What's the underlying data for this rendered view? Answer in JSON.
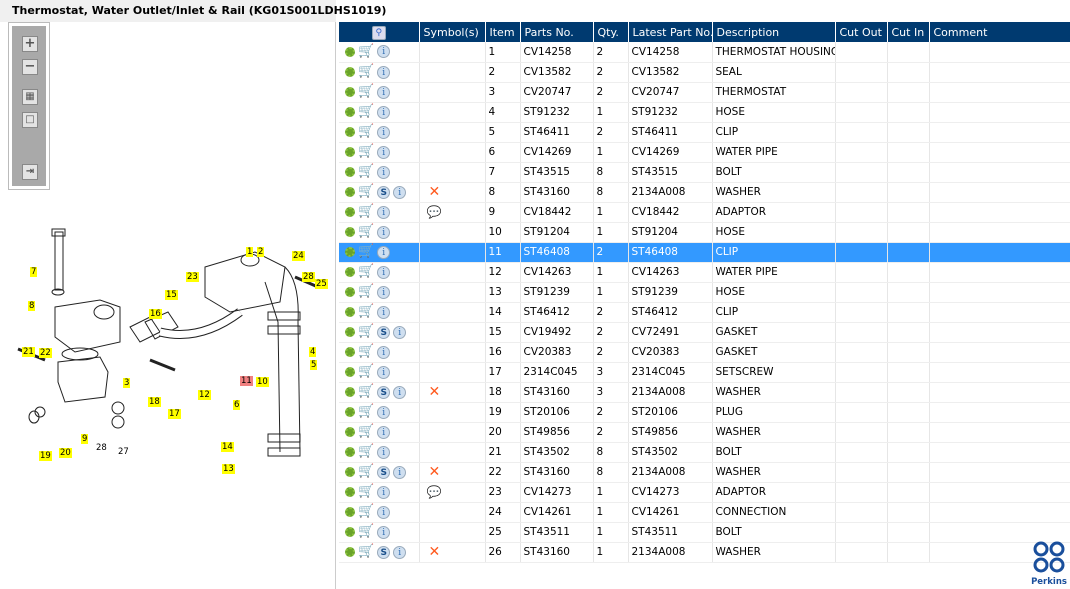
{
  "title": "Thermostat, Water Outlet/Inlet & Rail (KG01S001LDHS1019)",
  "toolbar": {
    "zoom_in": "+",
    "zoom_out": "−",
    "fit": "▦",
    "actual": "□",
    "export": "⇥"
  },
  "diagram_labels": [
    {
      "text": "1",
      "style": "yellow"
    },
    {
      "text": "2",
      "style": "yellow"
    },
    {
      "text": "24",
      "style": "yellow"
    },
    {
      "text": "28",
      "style": "yellow"
    },
    {
      "text": "25",
      "style": "yellow"
    },
    {
      "text": "23",
      "style": "yellow"
    },
    {
      "text": "15",
      "style": "yellow"
    },
    {
      "text": "16",
      "style": "yellow"
    },
    {
      "text": "7",
      "style": "yellow"
    },
    {
      "text": "8",
      "style": "yellow"
    },
    {
      "text": "21",
      "style": "yellow"
    },
    {
      "text": "22",
      "style": "yellow"
    },
    {
      "text": "3",
      "style": "yellow"
    },
    {
      "text": "4",
      "style": "yellow"
    },
    {
      "text": "5",
      "style": "yellow"
    },
    {
      "text": "11",
      "style": "red"
    },
    {
      "text": "10",
      "style": "yellow"
    },
    {
      "text": "12",
      "style": "yellow"
    },
    {
      "text": "6",
      "style": "yellow"
    },
    {
      "text": "18",
      "style": "yellow"
    },
    {
      "text": "17",
      "style": "yellow"
    },
    {
      "text": "9",
      "style": "yellow"
    },
    {
      "text": "28",
      "style": "plain"
    },
    {
      "text": "27",
      "style": "plain"
    },
    {
      "text": "19",
      "style": "yellow"
    },
    {
      "text": "20",
      "style": "yellow"
    },
    {
      "text": "14",
      "style": "yellow"
    },
    {
      "text": "13",
      "style": "yellow"
    }
  ],
  "table": {
    "headers": [
      "",
      "Symbol(s)",
      "Item",
      "Parts No.",
      "Qty.",
      "Latest Part No.",
      "Description",
      "Cut Out",
      "Cut In",
      "Comment"
    ],
    "selected_item": "11",
    "rows": [
      {
        "s": false,
        "sym": "",
        "item": "1",
        "part": "CV14258",
        "qty": "2",
        "latest": "CV14258",
        "desc": "THERMOSTAT HOUSING"
      },
      {
        "s": false,
        "sym": "",
        "item": "2",
        "part": "CV13582",
        "qty": "2",
        "latest": "CV13582",
        "desc": "SEAL"
      },
      {
        "s": false,
        "sym": "",
        "item": "3",
        "part": "CV20747",
        "qty": "2",
        "latest": "CV20747",
        "desc": "THERMOSTAT"
      },
      {
        "s": false,
        "sym": "",
        "item": "4",
        "part": "ST91232",
        "qty": "1",
        "latest": "ST91232",
        "desc": "HOSE"
      },
      {
        "s": false,
        "sym": "",
        "item": "5",
        "part": "ST46411",
        "qty": "2",
        "latest": "ST46411",
        "desc": "CLIP"
      },
      {
        "s": false,
        "sym": "",
        "item": "6",
        "part": "CV14269",
        "qty": "1",
        "latest": "CV14269",
        "desc": "WATER PIPE"
      },
      {
        "s": false,
        "sym": "",
        "item": "7",
        "part": "ST43515",
        "qty": "8",
        "latest": "ST43515",
        "desc": "BOLT"
      },
      {
        "s": true,
        "sym": "x",
        "item": "8",
        "part": "ST43160",
        "qty": "8",
        "latest": "2134A008",
        "desc": "WASHER"
      },
      {
        "s": false,
        "sym": "note",
        "item": "9",
        "part": "CV18442",
        "qty": "1",
        "latest": "CV18442",
        "desc": "ADAPTOR"
      },
      {
        "s": false,
        "sym": "",
        "item": "10",
        "part": "ST91204",
        "qty": "1",
        "latest": "ST91204",
        "desc": "HOSE"
      },
      {
        "s": false,
        "sym": "",
        "item": "11",
        "part": "ST46408",
        "qty": "2",
        "latest": "ST46408",
        "desc": "CLIP"
      },
      {
        "s": false,
        "sym": "",
        "item": "12",
        "part": "CV14263",
        "qty": "1",
        "latest": "CV14263",
        "desc": "WATER PIPE"
      },
      {
        "s": false,
        "sym": "",
        "item": "13",
        "part": "ST91239",
        "qty": "1",
        "latest": "ST91239",
        "desc": "HOSE"
      },
      {
        "s": false,
        "sym": "",
        "item": "14",
        "part": "ST46412",
        "qty": "2",
        "latest": "ST46412",
        "desc": "CLIP"
      },
      {
        "s": true,
        "sym": "",
        "item": "15",
        "part": "CV19492",
        "qty": "2",
        "latest": "CV72491",
        "desc": "GASKET"
      },
      {
        "s": false,
        "sym": "",
        "item": "16",
        "part": "CV20383",
        "qty": "2",
        "latest": "CV20383",
        "desc": "GASKET"
      },
      {
        "s": false,
        "sym": "",
        "item": "17",
        "part": "2314C045",
        "qty": "3",
        "latest": "2314C045",
        "desc": "SETSCREW"
      },
      {
        "s": true,
        "sym": "x",
        "item": "18",
        "part": "ST43160",
        "qty": "3",
        "latest": "2134A008",
        "desc": "WASHER"
      },
      {
        "s": false,
        "sym": "",
        "item": "19",
        "part": "ST20106",
        "qty": "2",
        "latest": "ST20106",
        "desc": "PLUG"
      },
      {
        "s": false,
        "sym": "",
        "item": "20",
        "part": "ST49856",
        "qty": "2",
        "latest": "ST49856",
        "desc": "WASHER"
      },
      {
        "s": false,
        "sym": "",
        "item": "21",
        "part": "ST43502",
        "qty": "8",
        "latest": "ST43502",
        "desc": "BOLT"
      },
      {
        "s": true,
        "sym": "x",
        "item": "22",
        "part": "ST43160",
        "qty": "8",
        "latest": "2134A008",
        "desc": "WASHER"
      },
      {
        "s": false,
        "sym": "note",
        "item": "23",
        "part": "CV14273",
        "qty": "1",
        "latest": "CV14273",
        "desc": "ADAPTOR"
      },
      {
        "s": false,
        "sym": "",
        "item": "24",
        "part": "CV14261",
        "qty": "1",
        "latest": "CV14261",
        "desc": "CONNECTION"
      },
      {
        "s": false,
        "sym": "",
        "item": "25",
        "part": "ST43511",
        "qty": "1",
        "latest": "ST43511",
        "desc": "BOLT"
      },
      {
        "s": true,
        "sym": "x",
        "item": "26",
        "part": "ST43160",
        "qty": "1",
        "latest": "2134A008",
        "desc": "WASHER"
      }
    ]
  },
  "logo": {
    "text": "Perkins"
  },
  "colors": {
    "header": "#003a70",
    "selected": "#3399ff",
    "label": "#ffff00"
  }
}
